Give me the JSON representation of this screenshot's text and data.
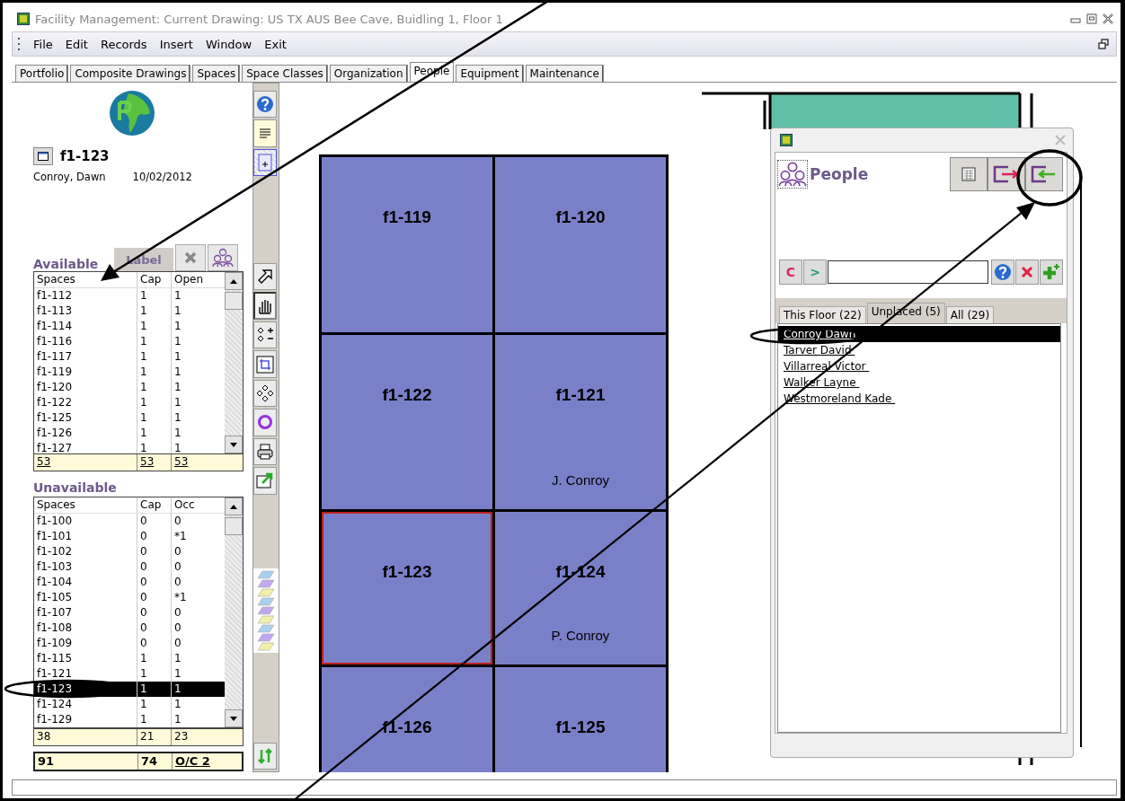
{
  "window": {
    "title": "Facility Management: Current Drawing: US TX AUS Bee Cave, Buidling 1, Floor 1"
  },
  "menu": [
    "File",
    "Edit",
    "Records",
    "Insert",
    "Window",
    "Exit"
  ],
  "tabs": [
    {
      "label": "Portfolio",
      "selected": false
    },
    {
      "label": "Composite Drawings",
      "selected": false
    },
    {
      "label": "Spaces",
      "selected": false
    },
    {
      "label": "Space Classes",
      "selected": false
    },
    {
      "label": "Organization",
      "selected": false
    },
    {
      "label": "People",
      "selected": true
    },
    {
      "label": "Equipment",
      "selected": false
    },
    {
      "label": "Maintenance",
      "selected": false
    }
  ],
  "current_space": {
    "id": "f1-123",
    "person": "Conroy, Dawn",
    "date": "10/02/2012"
  },
  "available": {
    "title": "Available",
    "label_button": "Label",
    "columns": [
      "Spaces",
      "Cap",
      "Open"
    ],
    "rows": [
      [
        "f1-112",
        "1",
        "1"
      ],
      [
        "f1-113",
        "1",
        "1"
      ],
      [
        "f1-114",
        "1",
        "1"
      ],
      [
        "f1-116",
        "1",
        "1"
      ],
      [
        "f1-117",
        "1",
        "1"
      ],
      [
        "f1-119",
        "1",
        "1"
      ],
      [
        "f1-120",
        "1",
        "1"
      ],
      [
        "f1-122",
        "1",
        "1"
      ],
      [
        "f1-125",
        "1",
        "1"
      ],
      [
        "f1-126",
        "1",
        "1"
      ],
      [
        "f1-127",
        "1",
        "1"
      ]
    ],
    "totals": [
      "53",
      "53",
      "53"
    ]
  },
  "unavailable": {
    "title": "Unavailable",
    "columns": [
      "Spaces",
      "Cap",
      "Occ"
    ],
    "rows": [
      {
        "cells": [
          "f1-100",
          "0",
          "0"
        ],
        "selected": false
      },
      {
        "cells": [
          "f1-101",
          "0",
          "*1"
        ],
        "selected": false
      },
      {
        "cells": [
          "f1-102",
          "0",
          "0"
        ],
        "selected": false
      },
      {
        "cells": [
          "f1-103",
          "0",
          "0"
        ],
        "selected": false
      },
      {
        "cells": [
          "f1-104",
          "0",
          "0"
        ],
        "selected": false
      },
      {
        "cells": [
          "f1-105",
          "0",
          "*1"
        ],
        "selected": false
      },
      {
        "cells": [
          "f1-107",
          "0",
          "0"
        ],
        "selected": false
      },
      {
        "cells": [
          "f1-108",
          "0",
          "0"
        ],
        "selected": false
      },
      {
        "cells": [
          "f1-109",
          "0",
          "0"
        ],
        "selected": false
      },
      {
        "cells": [
          "f1-115",
          "1",
          "1"
        ],
        "selected": false
      },
      {
        "cells": [
          "f1-121",
          "1",
          "1"
        ],
        "selected": false
      },
      {
        "cells": [
          "f1-123",
          "1",
          "1"
        ],
        "selected": true
      },
      {
        "cells": [
          "f1-124",
          "1",
          "1"
        ],
        "selected": false
      },
      {
        "cells": [
          "f1-129",
          "1",
          "1"
        ],
        "selected": false
      }
    ],
    "totals": [
      "38",
      "21",
      "23"
    ]
  },
  "grand_totals": [
    "91",
    "74",
    "O/C 2"
  ],
  "floor_plan": {
    "rooms": [
      {
        "id": "f1-119",
        "selected": false
      },
      {
        "id": "f1-120",
        "selected": false
      },
      {
        "id": "f1-122",
        "selected": false
      },
      {
        "id": "f1-121",
        "occupant": "J. Conroy",
        "selected": false
      },
      {
        "id": "f1-123",
        "selected": true
      },
      {
        "id": "f1-124",
        "occupant": "P. Conroy",
        "selected": false
      },
      {
        "id": "f1-126",
        "selected": false
      },
      {
        "id": "f1-125",
        "selected": false
      }
    ]
  },
  "people_panel": {
    "title": "People",
    "clear_button": "C",
    "go_button": ">",
    "tabs": [
      {
        "label": "This Floor (22)",
        "selected": false
      },
      {
        "label": "Unplaced (5)",
        "selected": true
      },
      {
        "label": "All (29)",
        "selected": false
      }
    ],
    "people": [
      {
        "name": "Conroy  Dawn",
        "selected": true
      },
      {
        "name": "Tarver  David",
        "selected": false
      },
      {
        "name": "Villarreal  Victor",
        "selected": false
      },
      {
        "name": "Walker  Layne",
        "selected": false
      },
      {
        "name": "Westmoreland  Kade",
        "selected": false
      }
    ]
  }
}
